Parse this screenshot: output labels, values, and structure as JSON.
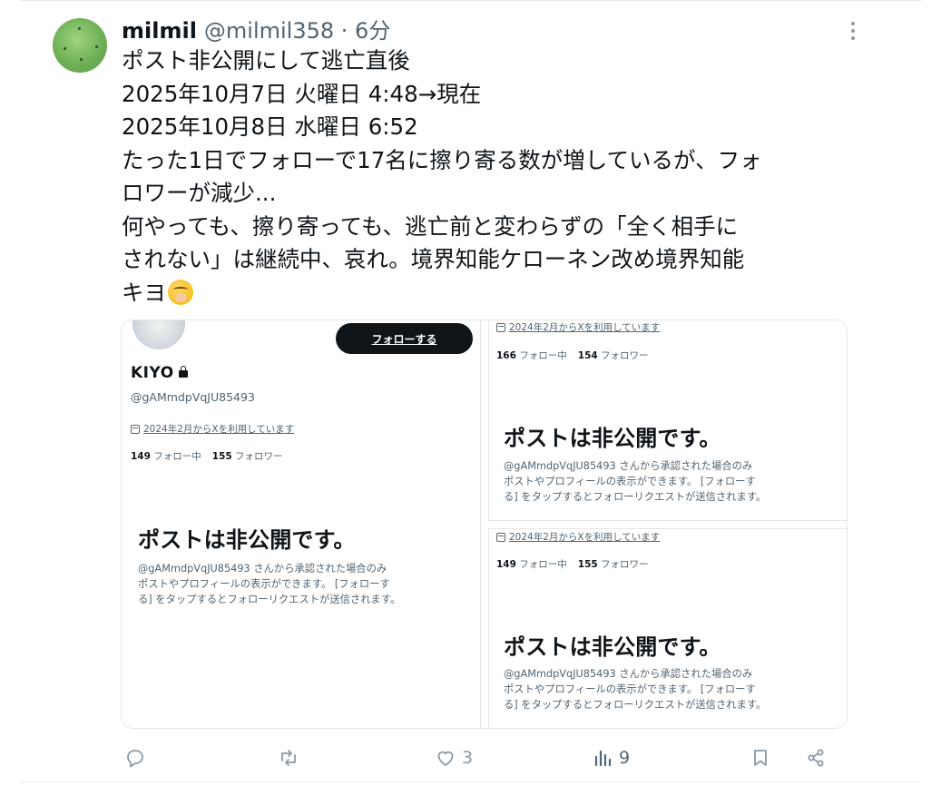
{
  "tweet": {
    "display_name": "milmil",
    "handle_meta": "@milmil358 · 6分",
    "text_lines": [
      "ポスト非公開にして逃亡直後",
      "2025年10月7日 火曜日 4:48→現在",
      "2025年10月8日 水曜日 6:52",
      "たった1日でフォローで17名に擦り寄る数が増しているが、フォ",
      "ロワーが減少...",
      "何やっても、擦り寄っても、逃亡前と変わらずの「全く相手に",
      "されない」は継続中、哀れ。境界知能ケローネン改め境界知能",
      "キヨ"
    ],
    "emoji": "face-with-hand-over-mouth"
  },
  "media": {
    "left": {
      "follow_button": "フォローする",
      "name": "KIYO",
      "handle": "@gAMmdpVqJU85493",
      "joined": "2024年2月からXを利用しています",
      "following_count": "149",
      "following_label": "フォロー中",
      "followers_count": "155",
      "followers_label": "フォロワー",
      "private_title": "ポストは非公開です。",
      "private_desc": [
        "@gAMmdpVqJU85493 さんから承認された場合のみ",
        "ポストやプロフィールの表示ができます。 [フォローす",
        "る] をタップするとフォローリクエストが送信されます。"
      ]
    },
    "right_top": {
      "joined": "2024年2月からXを利用しています",
      "following_count": "166",
      "following_label": "フォロー中",
      "followers_count": "154",
      "followers_label": "フォロワー",
      "private_title": "ポストは非公開です。",
      "private_desc": [
        "@gAMmdpVqJU85493 さんから承認された場合のみ",
        "ポストやプロフィールの表示ができます。 [フォローす",
        "る] をタップするとフォローリクエストが送信されます。"
      ]
    },
    "right_bottom": {
      "joined": "2024年2月からXを利用しています",
      "following_count": "149",
      "following_label": "フォロー中",
      "followers_count": "155",
      "followers_label": "フォロワー",
      "private_title": "ポストは非公開です。",
      "private_desc": [
        "@gAMmdpVqJU85493 さんから承認された場合のみ",
        "ポストやプロフィールの表示ができます。 [フォローす",
        "る] をタップするとフォローリクエストが送信されます。"
      ]
    }
  },
  "actions": {
    "reply_icon": "reply-icon",
    "repost_icon": "repost-icon",
    "like_icon": "heart-icon",
    "like_count": "3",
    "views_icon": "views-icon",
    "views_count": "9",
    "bookmark_icon": "bookmark-icon",
    "share_icon": "share-icon"
  },
  "colors": {
    "text": "#0f1419",
    "secondary": "#536471",
    "action_gray": "#8b98a5",
    "divider": "#e6e9ec"
  }
}
